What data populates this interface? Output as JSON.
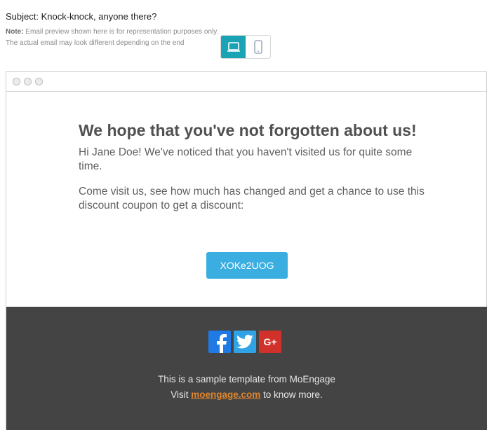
{
  "subject": "Subject: Knock-knock, anyone there?",
  "note": {
    "label": "Note:",
    "line1": " Email preview shown here is for representation purposes only.",
    "line2": "The actual email may look different depending on the end"
  },
  "view_toggle": {
    "desktop_icon": "laptop-icon",
    "mobile_icon": "mobile-icon",
    "active": "desktop",
    "accent": "#1aa3b4"
  },
  "email": {
    "headline": "We hope that you've not forgotten about us!",
    "para1": "Hi Jane Doe! We've noticed that you haven't visited us for quite some time.",
    "para2": "Come visit us, see how much has changed and get a chance to use this discount coupon to get a discount:",
    "coupon": "XOKe2UOG",
    "button_color": "#3aaee0"
  },
  "footer": {
    "socials": [
      "facebook-icon",
      "twitter-icon",
      "google-plus-icon"
    ],
    "google_plus_label": "G+",
    "line1": "This is a sample template from MoEngage",
    "visit": "Visit ",
    "link": "moengage.com",
    "after_link": " to know more.",
    "background": "#444444"
  }
}
